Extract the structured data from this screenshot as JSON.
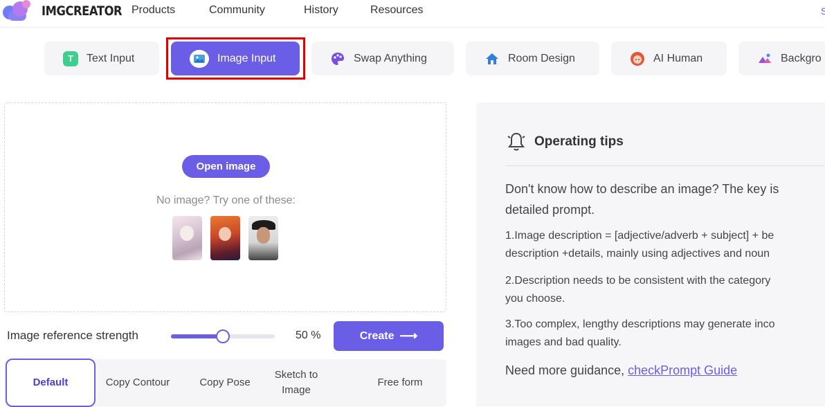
{
  "nav": {
    "brand": "IMGCREATOR",
    "links": [
      "Products",
      "Community",
      "History",
      "Resources"
    ],
    "edge_fragment": "S"
  },
  "tabs": [
    {
      "label": "Text Input",
      "icon": "text-t-icon",
      "glyph": "T",
      "color": "#3ecf8e",
      "active": false
    },
    {
      "label": "Image Input",
      "icon": "image-icon",
      "glyph": "",
      "color": "#4aa3e0",
      "active": true
    },
    {
      "label": "Swap Anything",
      "icon": "palette-icon",
      "glyph": "",
      "color": "#7a4ee0",
      "active": false
    },
    {
      "label": "Room Design",
      "icon": "house-icon",
      "glyph": "",
      "color": "#2f7fe0",
      "active": false
    },
    {
      "label": "AI Human",
      "icon": "person-icon",
      "glyph": "",
      "color": "#e05a3a",
      "active": false
    },
    {
      "label": "Backgro",
      "icon": "background-icon",
      "glyph": "",
      "color": "#9b4fe0",
      "active": false
    }
  ],
  "upload": {
    "open_label": "Open image",
    "hint": "No image? Try one of these:"
  },
  "strength": {
    "label": "Image reference strength",
    "value_text": "50 %",
    "value": 50
  },
  "create": {
    "label": "Create"
  },
  "modes": [
    {
      "label": "Default",
      "active": true
    },
    {
      "label": "Copy Contour",
      "active": false
    },
    {
      "label": "Copy Pose",
      "active": false
    },
    {
      "label": "Sketch to Image",
      "active": false
    },
    {
      "label": "Free form",
      "active": false
    }
  ],
  "tips": {
    "title": "Operating tips",
    "intro_line1": "Don't know how to describe an image? The key is",
    "intro_line2": "detailed prompt.",
    "tip1_line1": "1.Image description = [adjective/adverb + subject] + be",
    "tip1_line2": "description +details, mainly using adjectives and noun",
    "tip2_line1": "2.Description needs to be consistent with the category",
    "tip2_line2": "you choose.",
    "tip3_line1": "3.Too complex, lengthy descriptions may generate inco",
    "tip3_line2": "images and bad quality.",
    "more_prefix": "Need more guidance, ",
    "more_link": "checkPrompt Guide"
  },
  "colors": {
    "accent": "#6b5ee6",
    "highlight": "#e00000"
  }
}
